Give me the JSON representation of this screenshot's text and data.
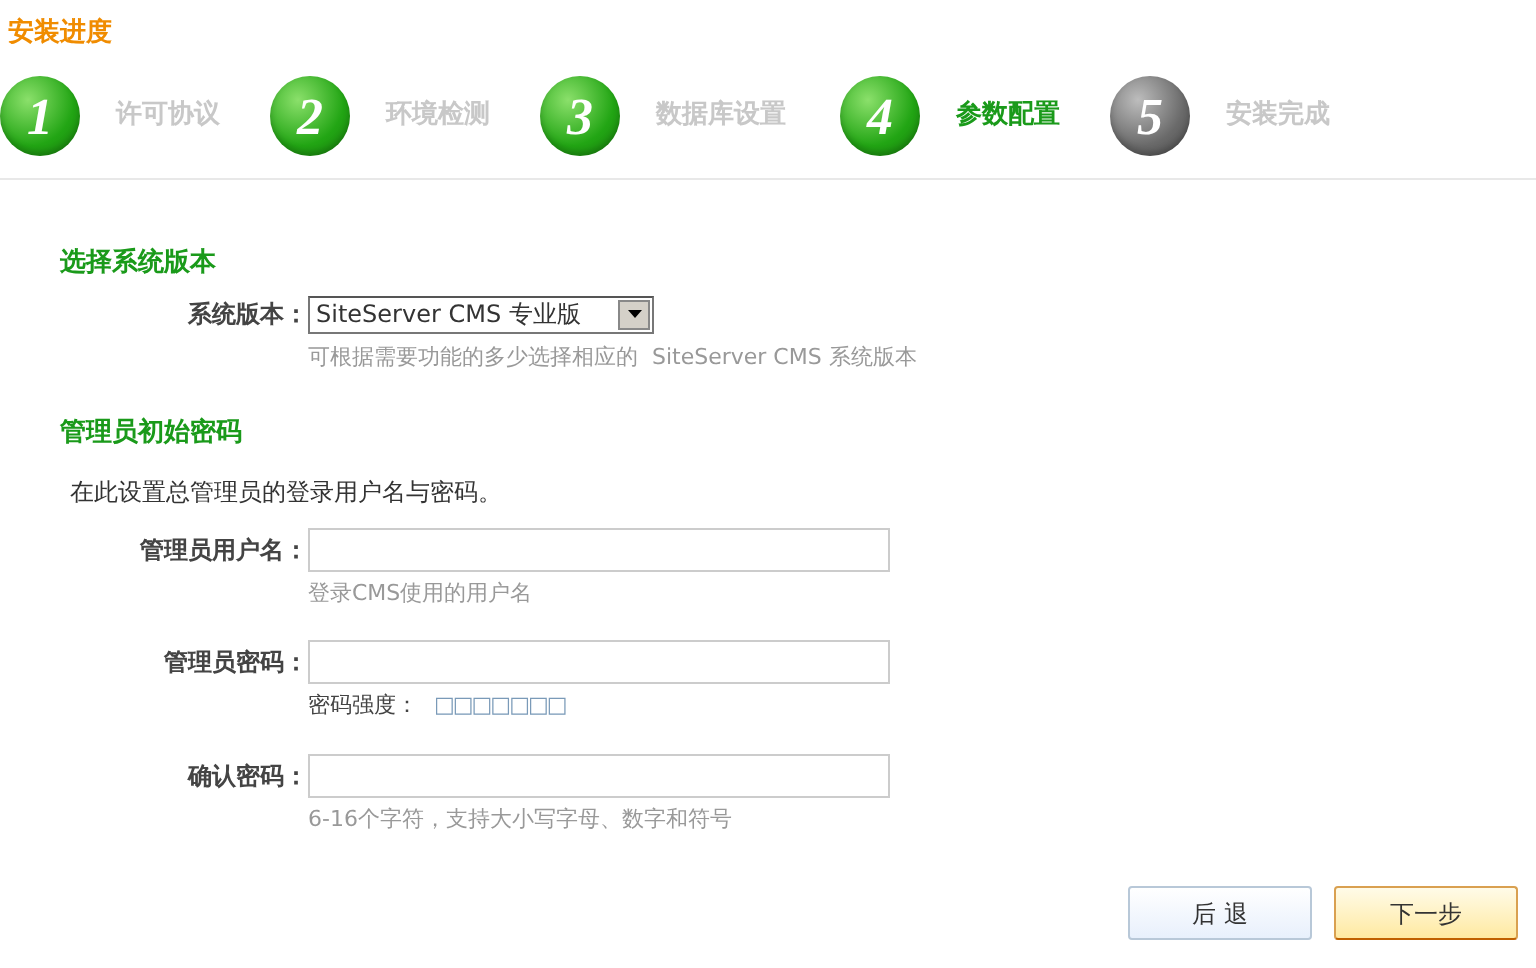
{
  "title": "安装进度",
  "steps": [
    {
      "number": "1",
      "label": "许可协议",
      "reached": true,
      "selected": false
    },
    {
      "number": "2",
      "label": "环境检测",
      "reached": true,
      "selected": false
    },
    {
      "number": "3",
      "label": "数据库设置",
      "reached": true,
      "selected": false
    },
    {
      "number": "4",
      "label": "参数配置",
      "reached": true,
      "selected": true
    },
    {
      "number": "5",
      "label": "安装完成",
      "reached": false,
      "selected": false
    }
  ],
  "version_section": {
    "heading": "选择系统版本",
    "label": "系统版本：",
    "value": "SiteServer CMS 专业版",
    "hint": "可根据需要功能的多少选择相应的  SiteServer CMS 系统版本"
  },
  "admin_section": {
    "heading": "管理员初始密码",
    "intro": "在此设置总管理员的登录用户名与密码。",
    "fields": [
      {
        "label": "管理员用户名：",
        "hint": "登录CMS使用的用户名"
      },
      {
        "label": "管理员密码：",
        "hint_label": "密码强度：",
        "strength": "□□□□□□□"
      },
      {
        "label": "确认密码：",
        "hint": "6-16个字符，支持大小写字母、数字和符号"
      }
    ]
  },
  "buttons": [
    {
      "label": "后 退",
      "kind": "secondary"
    },
    {
      "label": "下一步",
      "kind": "primary"
    }
  ]
}
